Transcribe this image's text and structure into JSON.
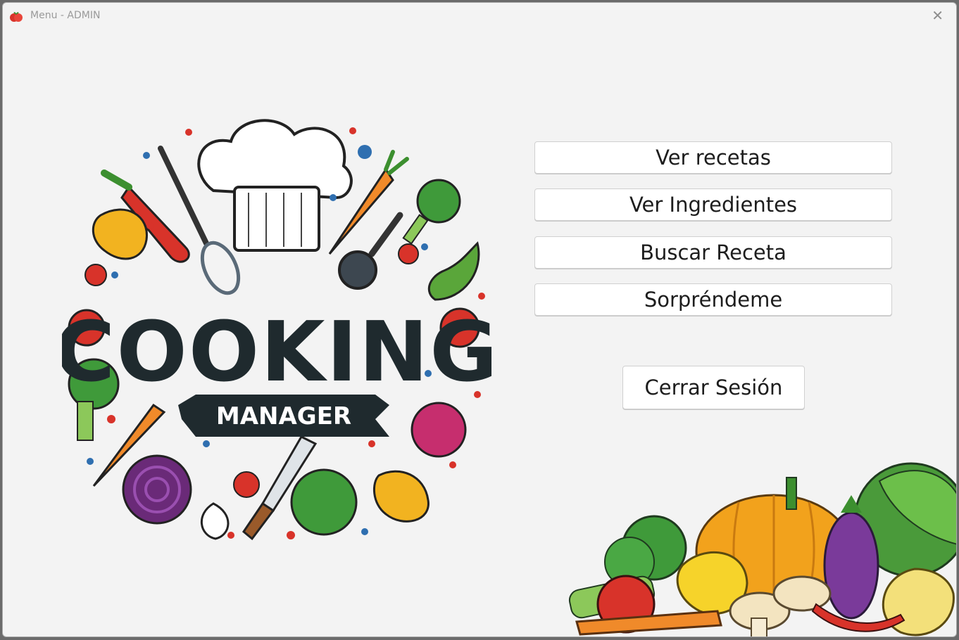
{
  "window": {
    "title": "Menu - ADMIN",
    "close_glyph": "✕"
  },
  "logo": {
    "title": "COOKING",
    "subtitle": "MANAGER"
  },
  "menu": {
    "buttons": [
      {
        "label": "Ver recetas"
      },
      {
        "label": "Ver Ingredientes"
      },
      {
        "label": "Buscar Receta"
      },
      {
        "label": "Sorpréndeme"
      }
    ],
    "logout_label": "Cerrar Sesión"
  },
  "colors": {
    "window_bg": "#f3f3f3",
    "button_bg": "#ffffff",
    "accent_carrot": "#f08a2a",
    "banner": "#1f2a2e"
  }
}
